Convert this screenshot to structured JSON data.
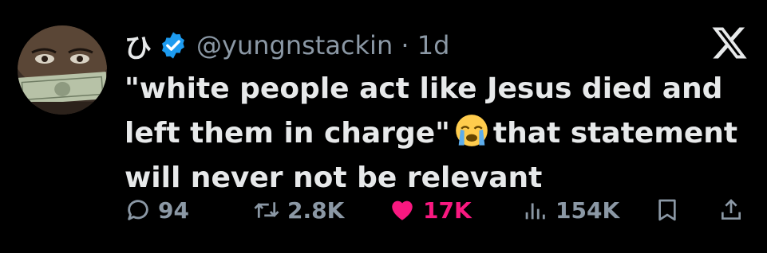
{
  "author": {
    "display_name": "ひ",
    "handle_time": "@yungnstackin · 1d",
    "verified": true
  },
  "tweet": {
    "line1": "\"white people act like Jesus died and",
    "line2_a": "left them in charge\"",
    "line2_b": "that statement",
    "line3": "will never not be relevant",
    "emoji": "loudly-crying-face"
  },
  "actions": {
    "replies": "94",
    "reposts": "2.8K",
    "likes": "17K",
    "views": "154K"
  },
  "colors": {
    "background": "#000000",
    "text": "#e7e9ea",
    "muted": "#8b98a5",
    "verified": "#1d9bf0",
    "like": "#f91880"
  }
}
